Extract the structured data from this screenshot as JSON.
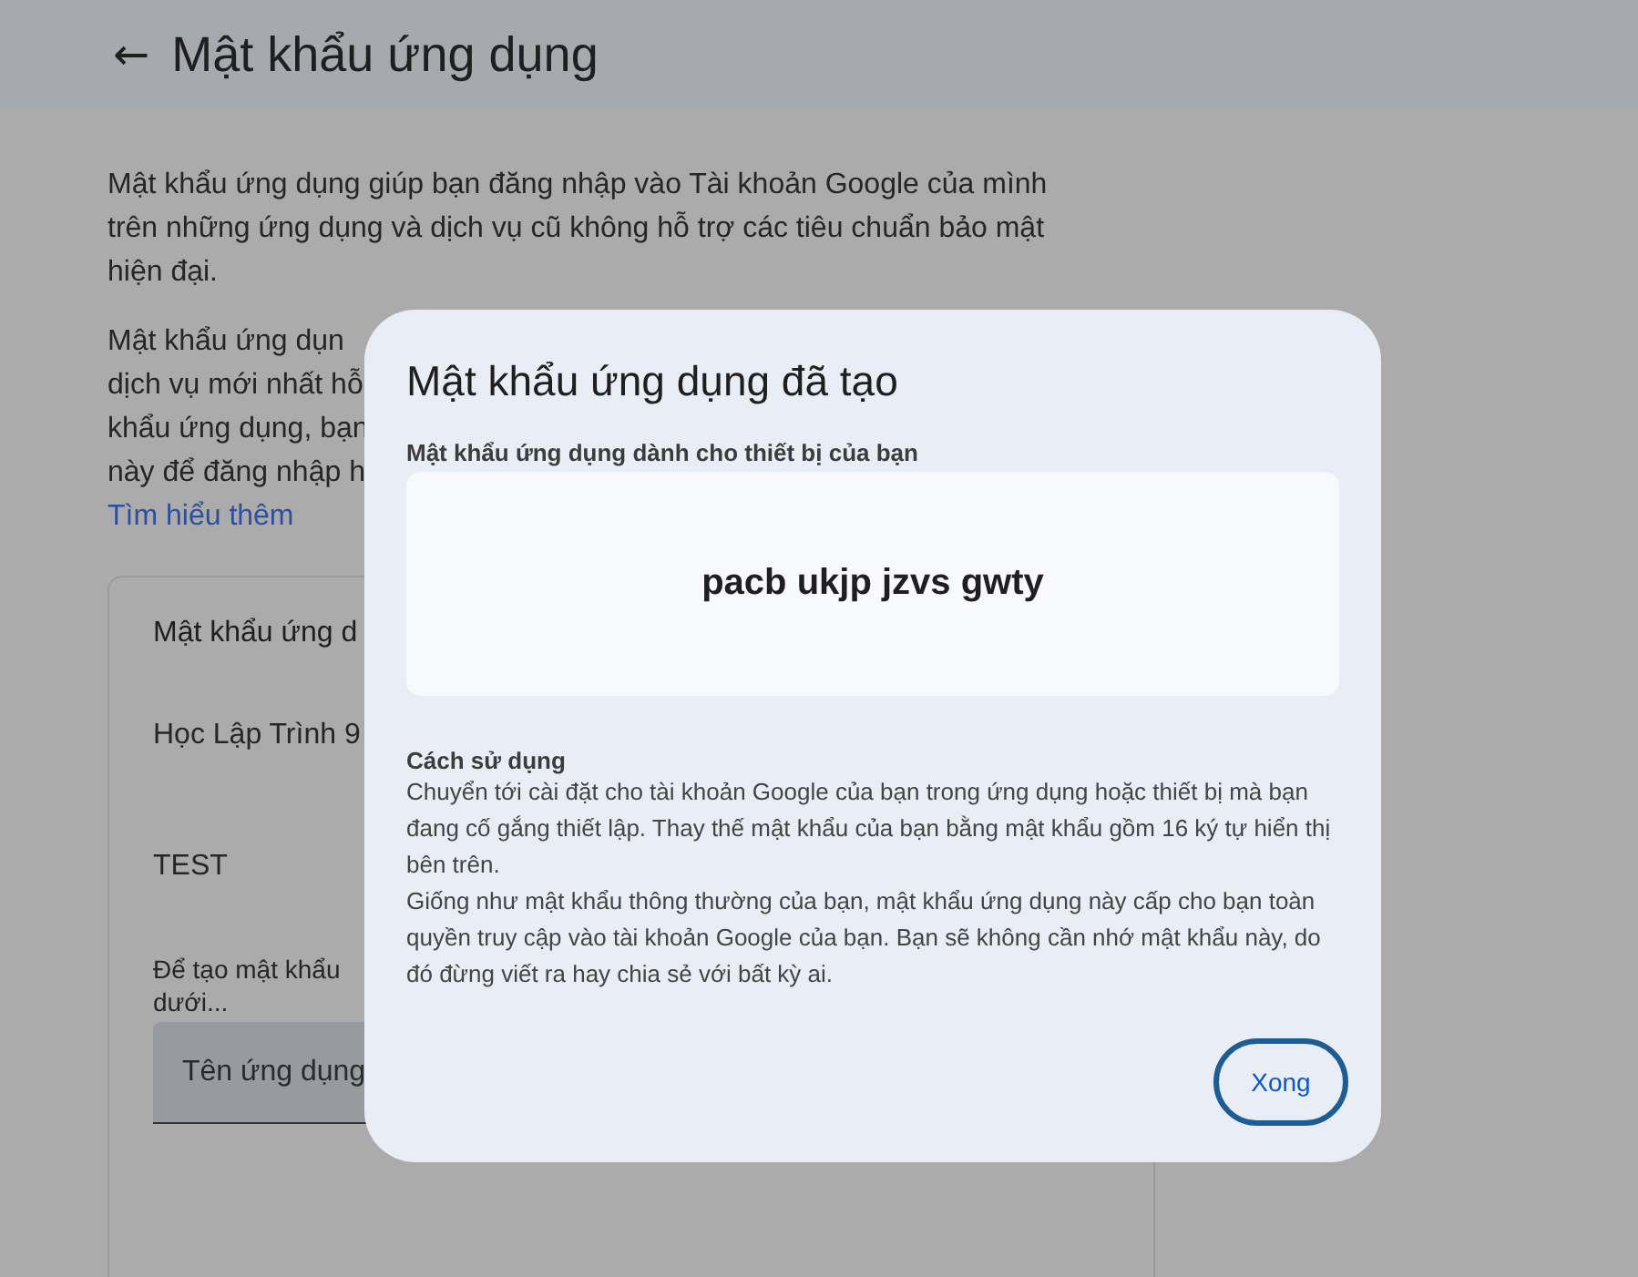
{
  "header": {
    "back_icon": "←",
    "title": "Mật khẩu ứng dụng"
  },
  "intro": {
    "paragraph_1": "Mật khẩu ứng dụng giúp bạn đăng nhập vào Tài khoản Google của mình trên những ứng dụng và dịch vụ cũ không hỗ trợ các tiêu chuẩn bảo mật hiện đại.",
    "paragraph_2_lines": [
      "Mật khẩu ứng dụn",
      "dịch vụ mới nhất hỗ",
      "khẩu ứng dụng, bạn",
      "này để đăng nhập h"
    ],
    "link": "Tìm hiểu thêm"
  },
  "card": {
    "heading": "Mật khẩu ứng d",
    "items": [
      "Học Lập Trình 9",
      "TEST"
    ],
    "hint_lines": [
      "Để tạo mật khẩu",
      "dưới..."
    ],
    "field": {
      "placeholder": "Tên ứng dụng"
    }
  },
  "dialog": {
    "title": "Mật khẩu ứng dụng đã tạo",
    "password_label": "Mật khẩu ứng dụng dành cho thiết bị của bạn",
    "password": "pacb ukjp jzvs gwty",
    "usage_heading": "Cách sử dụng",
    "usage_paragraphs": [
      "Chuyển tới cài đặt cho tài khoản Google của bạn trong ứng dụng hoặc thiết bị mà bạn đang cố gắng thiết lập. Thay thế mật khẩu của bạn bằng mật khẩu gồm 16 ký tự hiển thị bên trên.",
      "Giống như mật khẩu thông thường của bạn, mật khẩu ứng dụng này cấp cho bạn toàn quyền truy cập vào tài khoản Google của bạn. Bạn sẽ không cần nhớ mật khẩu này, do đó đừng viết ra hay chia sẻ với bất kỳ ai."
    ],
    "button": "Xong"
  }
}
